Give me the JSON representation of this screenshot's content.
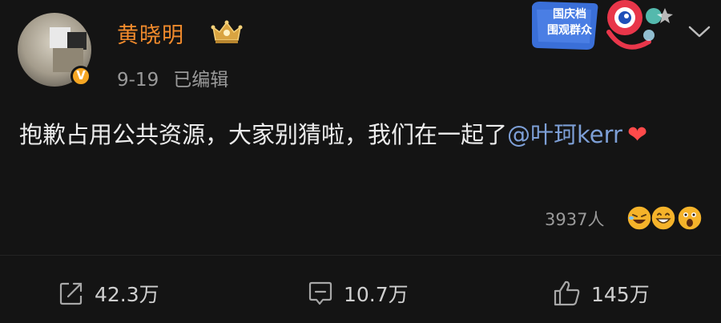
{
  "post": {
    "username": "黄晓明",
    "date": "9-19",
    "edited_label": "已编辑",
    "content_text": "抱歉占用公共资源，大家别猜啦，我们在一起了",
    "mention": "@叶珂kerr",
    "heart": "❤"
  },
  "sticker": {
    "line1": "国庆档",
    "line2": "围观群众"
  },
  "reactions": {
    "count_label": "3937人"
  },
  "actions": {
    "share_count": "42.3万",
    "comment_count": "10.7万",
    "like_count": "145万"
  },
  "colors": {
    "background": "#141414",
    "username": "#f08a2c",
    "mention": "#7d9fd6",
    "verified": "#f5a623"
  },
  "icons": [
    "verified-badge-icon",
    "crown-badge-icon",
    "chevron-down-icon",
    "share-icon",
    "comment-icon",
    "like-icon"
  ]
}
